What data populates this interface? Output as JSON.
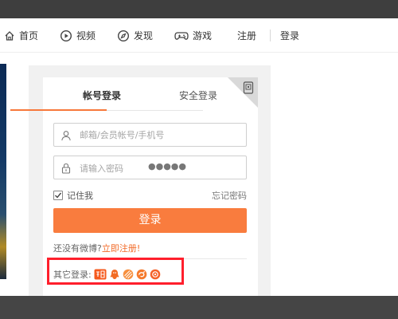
{
  "nav": {
    "items": [
      {
        "label": "首页",
        "icon": "home-icon"
      },
      {
        "label": "视频",
        "icon": "video-icon"
      },
      {
        "label": "发现",
        "icon": "compass-icon"
      },
      {
        "label": "游戏",
        "icon": "gamepad-icon"
      }
    ],
    "register": "注册",
    "login": "登录"
  },
  "login": {
    "tabs": [
      "帐号登录",
      "安全登录"
    ],
    "username_placeholder": "邮箱/会员帐号/手机号",
    "password_placeholder": "请输入密码",
    "password_mask": "●●●●●",
    "remember_label": "记住我",
    "forgot_label": "忘记密码",
    "login_button": "登录",
    "no_account": "还没有微博?",
    "register_link": "立即注册!",
    "other_login_label": "其它登录:",
    "other_icons": [
      "taobao-icon",
      "qq-icon",
      "tianyi-icon",
      "360-icon",
      "baidu-icon"
    ]
  },
  "colors": {
    "accent": "#f97c3e",
    "highlight_border": "#ff1f2c",
    "top_bar": "#3e3e3e"
  }
}
